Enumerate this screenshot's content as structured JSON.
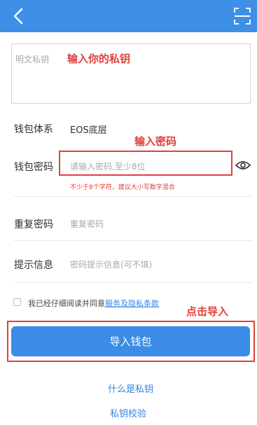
{
  "header": {
    "back_icon": "chevron-left-icon",
    "scan_icon": "scan-icon",
    "background": "#3d8fe8"
  },
  "private_key": {
    "placeholder": "明文私钥",
    "annotation": "输入你的私钥"
  },
  "wallet_system": {
    "label": "钱包体系",
    "value": "EOS底层"
  },
  "wallet_password": {
    "label": "钱包密码",
    "placeholder": "请输入密码,至少8位",
    "annotation": "输入密码",
    "hint": "不少于8个字符，建议大小写数字混合",
    "eye_icon": "eye-icon"
  },
  "repeat_password": {
    "label": "重复密码",
    "placeholder": "重复密码"
  },
  "password_hint": {
    "label": "提示信息",
    "placeholder": "密码提示信息(可不填)"
  },
  "agreement": {
    "prefix": "我已经仔细阅读并同意",
    "link": "服务及隐私条款"
  },
  "import": {
    "annotation": "点击导入",
    "button_label": "导入钱包"
  },
  "links": {
    "what_is_key": "什么是私钥",
    "verify_key": "私钥校验"
  },
  "colors": {
    "accent": "#3a8ce6",
    "annotation_red": "#e0403a",
    "link_blue": "#2f86e6"
  }
}
